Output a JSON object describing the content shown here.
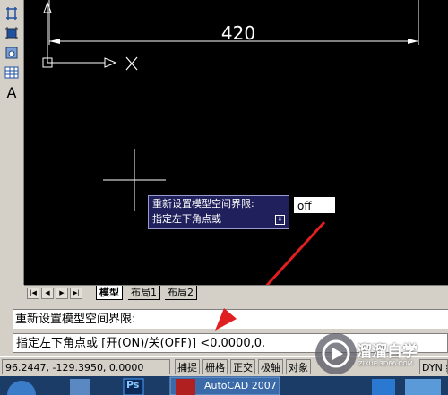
{
  "canvas": {
    "dimension_text": "420",
    "background": "#000000"
  },
  "left_toolbar": {
    "icons": [
      "dimension-icon",
      "block-icon",
      "region-icon",
      "table-icon",
      "text-icon"
    ],
    "text_tool_glyph": "A"
  },
  "tooltip": {
    "line1": "重新设置模型空间界限:",
    "line2": "指定左下角点或",
    "arrow": "⇓"
  },
  "dynamic_input": {
    "value": "off"
  },
  "layout_tabs": {
    "nav": [
      "|◀",
      "◀",
      "▶",
      "▶|"
    ],
    "tabs": [
      "模型",
      "布局1",
      "布局2"
    ],
    "active": "模型"
  },
  "command": {
    "line1": "重新设置模型空间界限:",
    "line2": "指定左下角点或 [开(ON)/关(OFF)] <0.0000,0."
  },
  "status_bar": {
    "coords": "96.2447,  -129.3950, 0.0000",
    "buttons": [
      "捕捉",
      "栅格",
      "正交",
      "极轴",
      "对象"
    ],
    "right_text": "DYN  线"
  },
  "taskbar": {
    "autocad_label": "AutoCAD 2007",
    "ps_label": "Ps"
  },
  "watermark": {
    "title": "溜溜自学",
    "subtitle": "ZIXUE.3D66.COM"
  },
  "colors": {
    "tooltip_bg": "#20205c",
    "arrow_red": "#e02020",
    "taskbar_bg": "#1c3c68"
  }
}
